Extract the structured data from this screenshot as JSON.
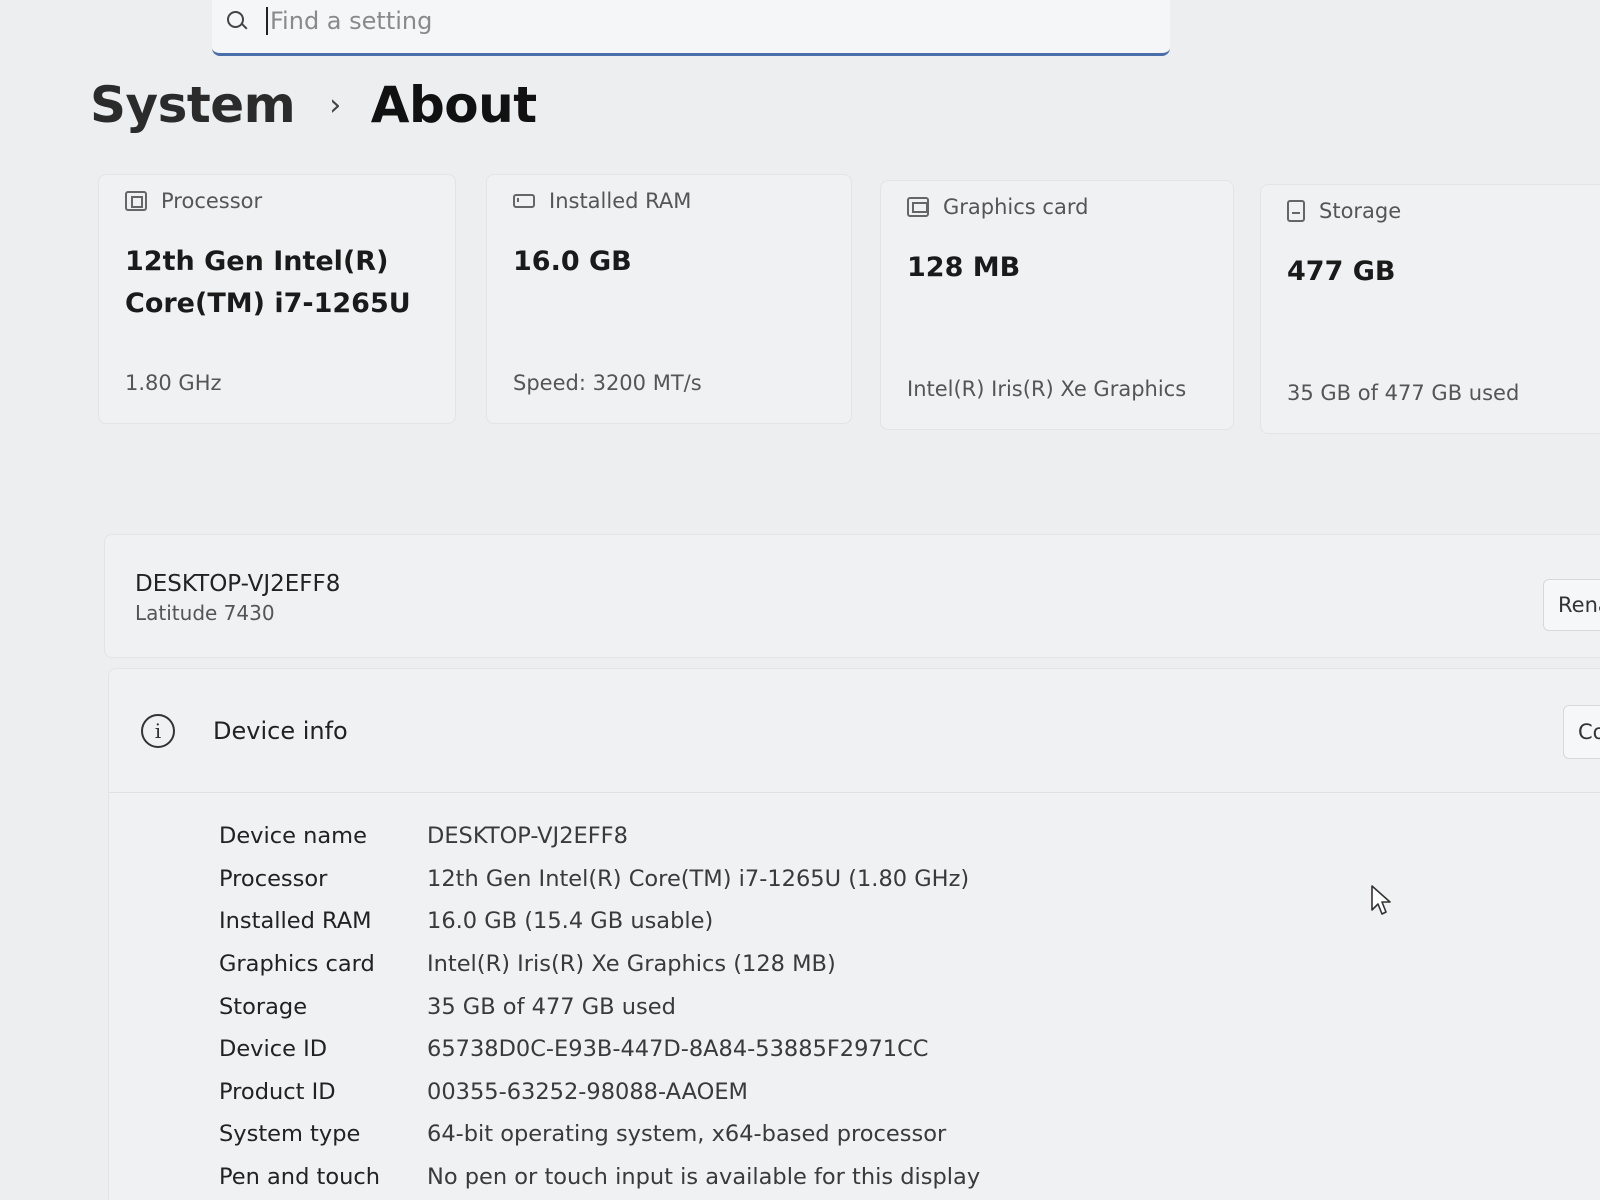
{
  "search": {
    "placeholder": "Find a setting"
  },
  "breadcrumb": {
    "parent": "System",
    "separator": "›",
    "current": "About"
  },
  "cards": [
    {
      "title": "Processor",
      "icon": "processor-icon",
      "value": "12th Gen Intel(R) Core(TM) i7-1265U",
      "sub": "1.80 GHz"
    },
    {
      "title": "Installed RAM",
      "icon": "ram-icon",
      "value": "16.0 GB",
      "sub": "Speed: 3200 MT/s"
    },
    {
      "title": "Graphics card",
      "icon": "graphics-card-icon",
      "value": "128 MB",
      "sub": "Intel(R) Iris(R) Xe Graphics"
    },
    {
      "title": "Storage",
      "icon": "storage-icon",
      "value": "477 GB",
      "sub": "35 GB of 477 GB used"
    }
  ],
  "device": {
    "name": "DESKTOP-VJ2EFF8",
    "model": "Latitude 7430",
    "rename_label": "Rename"
  },
  "device_info": {
    "title": "Device info",
    "copy_label": "Copy",
    "rows": [
      {
        "label": "Device name",
        "value": "DESKTOP-VJ2EFF8"
      },
      {
        "label": "Processor",
        "value": "12th Gen Intel(R) Core(TM) i7-1265U (1.80 GHz)"
      },
      {
        "label": "Installed RAM",
        "value": "16.0 GB (15.4 GB usable)"
      },
      {
        "label": "Graphics card",
        "value": "Intel(R) Iris(R) Xe Graphics (128 MB)"
      },
      {
        "label": "Storage",
        "value": "35 GB of 477 GB used"
      },
      {
        "label": "Device ID",
        "value": "65738D0C-E93B-447D-8A84-53885F2971CC"
      },
      {
        "label": "Product ID",
        "value": "00355-63252-98088-AAOEM"
      },
      {
        "label": "System type",
        "value": "64-bit operating system, x64-based processor"
      },
      {
        "label": "Pen and touch",
        "value": "No pen or touch input is available for this display"
      }
    ]
  }
}
